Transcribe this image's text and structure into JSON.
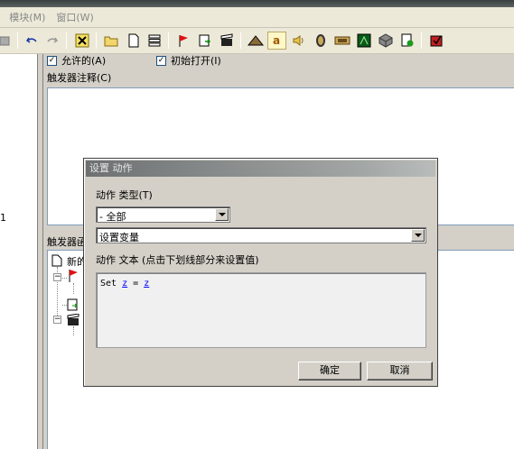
{
  "menu": {
    "items": [
      ")",
      "模块(M)",
      "窗口(W)"
    ]
  },
  "toolbar": {
    "icons": [
      "document-gray-icon",
      "undo-icon",
      "redo-icon",
      "delete-icon",
      "folder-icon",
      "new-file-icon",
      "variables-icon",
      "flag-icon",
      "import-icon",
      "clapper-icon",
      "terrain-icon",
      "text-a-icon",
      "sound-icon",
      "unit-icon",
      "money-icon",
      "ai-icon",
      "object-icon",
      "export-icon",
      "test-map-icon"
    ]
  },
  "left_pane": {
    "row_number": "1"
  },
  "trigger_panel": {
    "enabled_label": "允许的(A)",
    "enabled_checked": true,
    "initially_on_label": "初始打开(I)",
    "initially_on_checked": true,
    "comment_label": "触发器注释(C)",
    "functions_label": "触发器函",
    "tree_root_label": "新的"
  },
  "dialog": {
    "title": "设置 动作",
    "type_label": "动作 类型(T)",
    "type_value": "- 全部",
    "action_value": "设置变量",
    "text_label": "动作 文本 (点击下划线部分来设置值)",
    "action_text": {
      "prefix": "Set ",
      "var1": "z",
      "middle": " = ",
      "var2": "z"
    },
    "ok_label": "确定",
    "cancel_label": "取消"
  }
}
